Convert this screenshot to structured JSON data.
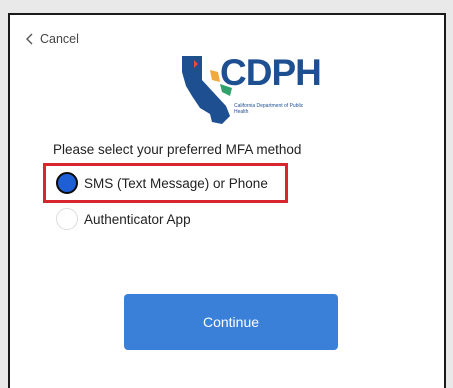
{
  "header": {
    "cancel_label": "Cancel",
    "logo_text": "CDPH",
    "logo_subtitle": "California Department of Public Health"
  },
  "main": {
    "prompt": "Please select your preferred MFA method",
    "options": [
      {
        "label": "SMS (Text Message) or Phone",
        "selected": true
      },
      {
        "label": "Authenticator App",
        "selected": false
      }
    ],
    "continue_label": "Continue"
  },
  "colors": {
    "primary_button": "#3a7fd8",
    "selected_radio": "#1f5fd6",
    "highlight_box": "#d8262e",
    "logo_blue": "#1d4f91"
  },
  "icons": [
    "chevron-left-icon",
    "california-map-icon"
  ]
}
